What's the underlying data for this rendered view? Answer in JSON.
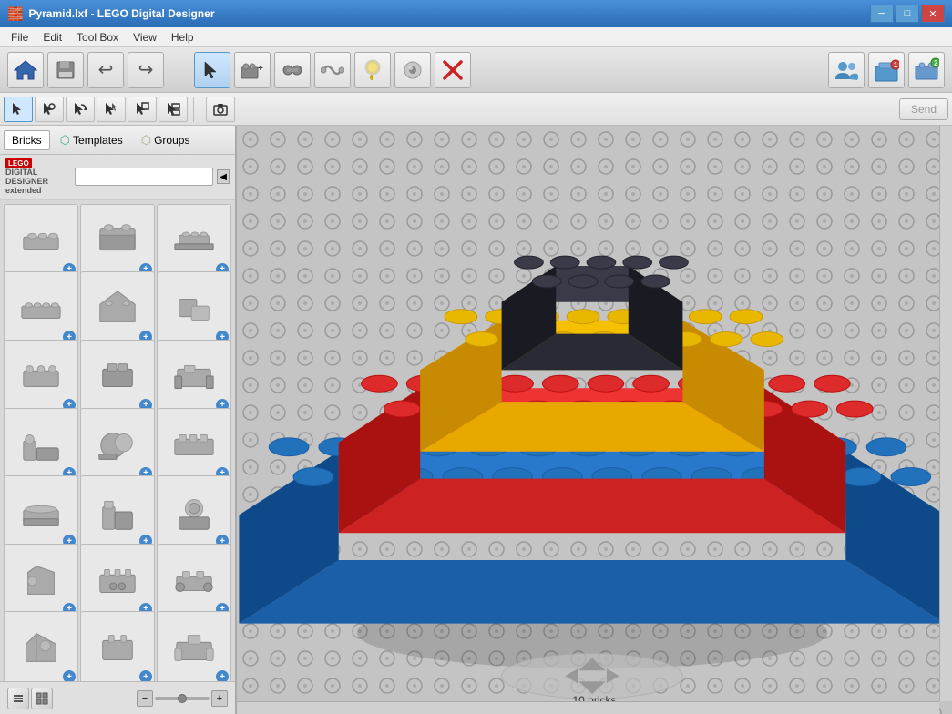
{
  "window": {
    "title": "Pyramid.lxf - LEGO Digital Designer",
    "icon": "🧱"
  },
  "title_bar": {
    "minimize_label": "─",
    "maximize_label": "□",
    "close_label": "✕"
  },
  "menu": {
    "items": [
      "File",
      "Edit",
      "Tool Box",
      "View",
      "Help"
    ]
  },
  "toolbar": {
    "main_tools": [
      {
        "name": "home-btn",
        "icon": "🏠",
        "label": "Home"
      },
      {
        "name": "save-btn",
        "icon": "💾",
        "label": "Save"
      },
      {
        "name": "undo-btn",
        "icon": "↩",
        "label": "Undo"
      },
      {
        "name": "redo-btn",
        "icon": "↪",
        "label": "Redo"
      }
    ],
    "right_tools": [
      {
        "name": "select-btn",
        "icon": "↖",
        "label": "Select",
        "active": true
      },
      {
        "name": "add-brick-btn",
        "icon": "🧱+",
        "label": "Add Brick"
      },
      {
        "name": "hinge-btn",
        "icon": "🔧",
        "label": "Hinge"
      },
      {
        "name": "flex-btn",
        "icon": "〜",
        "label": "Flex"
      },
      {
        "name": "paint-btn",
        "icon": "🎨",
        "label": "Paint"
      },
      {
        "name": "eye-btn",
        "icon": "👁",
        "label": "View"
      },
      {
        "name": "delete-btn",
        "icon": "✖",
        "label": "Delete"
      }
    ],
    "far_right": [
      {
        "name": "community-btn",
        "icon": "👥",
        "label": "Community"
      },
      {
        "name": "models-btn",
        "icon": "📦",
        "label": "Models"
      },
      {
        "name": "build-btn",
        "icon": "🔨",
        "label": "Build"
      }
    ]
  },
  "secondary_toolbar": {
    "tools": [
      {
        "name": "select-tool",
        "icon": "↖",
        "active": true
      },
      {
        "name": "move-tool",
        "icon": "✛"
      },
      {
        "name": "rotate-tool",
        "icon": "↺"
      },
      {
        "name": "clone-tool",
        "icon": "⧉"
      },
      {
        "name": "hide-tool",
        "icon": "◻"
      },
      {
        "name": "group-tool",
        "icon": "⊞"
      },
      {
        "name": "camera-tool",
        "icon": "📷"
      }
    ],
    "send_label": "Send",
    "send_disabled": true
  },
  "left_panel": {
    "tabs": [
      {
        "id": "bricks",
        "label": "Bricks",
        "active": true
      },
      {
        "id": "templates",
        "label": "Templates"
      },
      {
        "id": "groups",
        "label": "Groups"
      }
    ],
    "search_placeholder": "",
    "lego_logo": "LEGO",
    "dd_line1": "DIGITAL DESIGNER",
    "dd_line2": "extended",
    "brick_rows": [
      [
        {
          "id": "b1"
        },
        {
          "id": "b2"
        },
        {
          "id": "b3"
        }
      ],
      [
        {
          "id": "b4"
        },
        {
          "id": "b5"
        },
        {
          "id": "b6"
        }
      ],
      [
        {
          "id": "b7"
        },
        {
          "id": "b8"
        },
        {
          "id": "b9"
        }
      ],
      [
        {
          "id": "b10"
        },
        {
          "id": "b11"
        },
        {
          "id": "b12"
        }
      ],
      [
        {
          "id": "b13"
        },
        {
          "id": "b14"
        },
        {
          "id": "b15"
        }
      ],
      [
        {
          "id": "b16"
        },
        {
          "id": "b17"
        },
        {
          "id": "b18"
        }
      ],
      [
        {
          "id": "b19"
        },
        {
          "id": "b20"
        },
        {
          "id": "b21"
        }
      ]
    ],
    "zoom_minus": "−",
    "zoom_plus": "+",
    "view_list": "☰",
    "view_grid": "⊞"
  },
  "viewport": {
    "brick_count_label": "10 bricks"
  },
  "colors": {
    "blue_brick": "#1a5fa8",
    "red_brick": "#cc2222",
    "yellow_brick": "#e8a800",
    "black_brick": "#222233",
    "stud_blue": "#1666bb",
    "stud_red": "#cc3333",
    "stud_yellow": "#d4a000",
    "stud_black": "#333344",
    "grid_bg": "#c0c0c0",
    "grid_line": "#aaa"
  }
}
